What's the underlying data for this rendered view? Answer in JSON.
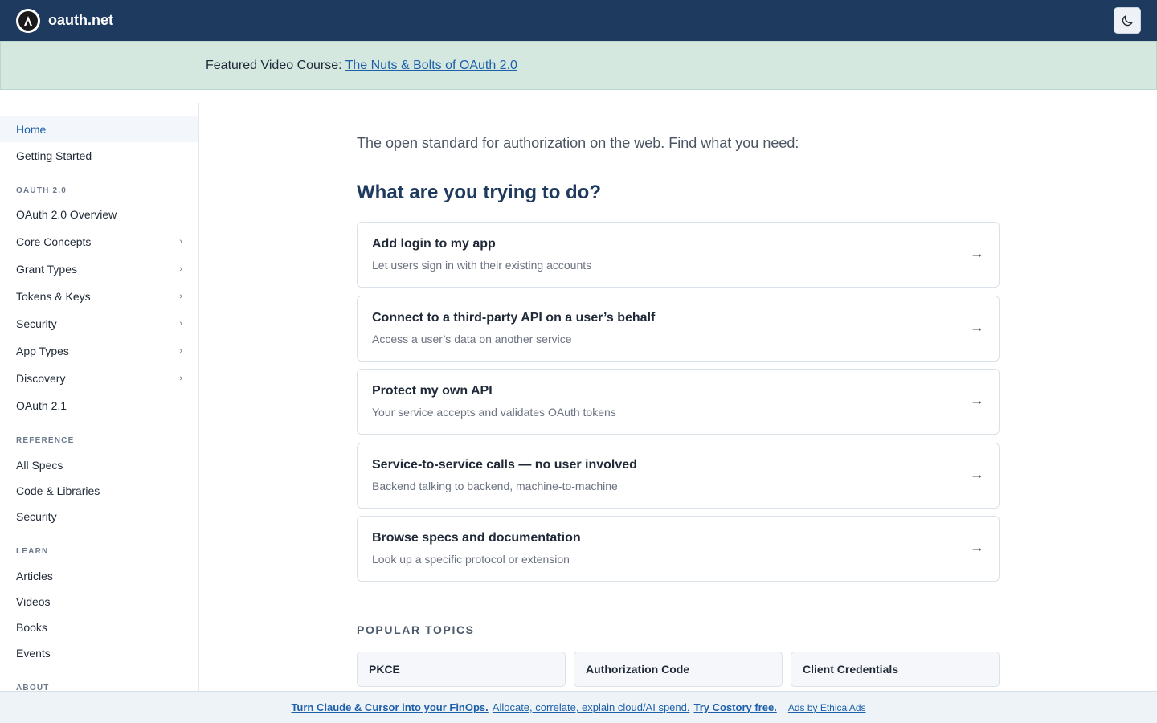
{
  "header": {
    "brand": "oauth.net",
    "logo_icon": "oauth-logo-icon",
    "theme_icon": "moon-icon",
    "bg_color": "#1f3a5f"
  },
  "banner": {
    "prefix": "Featured Video Course:",
    "link_text": "The Nuts & Bolts of OAuth 2.0",
    "bg_color": "#d4e8df"
  },
  "sidebar": {
    "home": "Home",
    "getting_started": "Getting Started",
    "sections": {
      "oauth2": "OAUTH 2.0",
      "reference": "REFERENCE",
      "learn": "LEARN",
      "about": "ABOUT"
    },
    "oauth2_items": [
      {
        "label": "OAuth 2.0 Overview",
        "expandable": false
      },
      {
        "label": "Core Concepts",
        "expandable": true
      },
      {
        "label": "Grant Types",
        "expandable": true
      },
      {
        "label": "Tokens & Keys",
        "expandable": true
      },
      {
        "label": "Security",
        "expandable": true
      },
      {
        "label": "App Types",
        "expandable": true
      },
      {
        "label": "Discovery",
        "expandable": true
      },
      {
        "label": "OAuth 2.1",
        "expandable": false
      }
    ],
    "reference_items": [
      "All Specs",
      "Code & Libraries",
      "Security"
    ],
    "learn_items": [
      "Articles",
      "Videos",
      "Books",
      "Events"
    ],
    "chevron": "›"
  },
  "main": {
    "lede": "The open standard for authorization on the web. Find what you need:",
    "question": "What are you trying to do?",
    "arrow": "→",
    "cards": [
      {
        "title": "Add login to my app",
        "subtitle": "Let users sign in with their existing accounts"
      },
      {
        "title": "Connect to a third-party API on a user’s behalf",
        "subtitle": "Access a user’s data on another service"
      },
      {
        "title": "Protect my own API",
        "subtitle": "Your service accepts and validates OAuth tokens"
      },
      {
        "title": "Service-to-service calls — no user involved",
        "subtitle": "Backend talking to backend, machine-to-machine"
      },
      {
        "title": "Browse specs and documentation",
        "subtitle": "Look up a specific protocol or extension"
      }
    ],
    "popular_label": "POPULAR TOPICS",
    "topics": [
      "PKCE",
      "Authorization Code",
      "Client Credentials"
    ]
  },
  "ad": {
    "headline": "Turn Claude & Cursor into your FinOps.",
    "body": "Allocate, correlate, explain cloud/AI spend.",
    "cta": "Try Costory free.",
    "attribution": "Ads by EthicalAds"
  }
}
